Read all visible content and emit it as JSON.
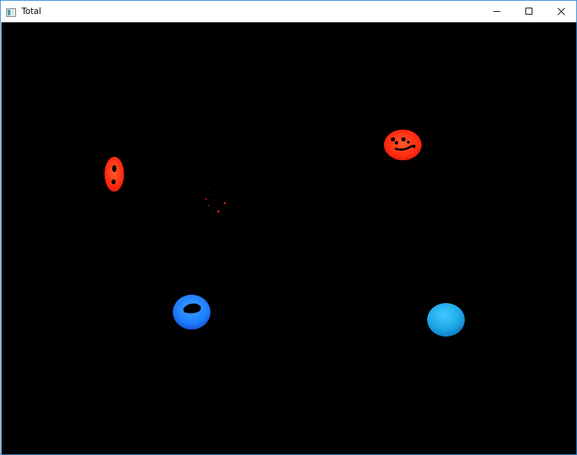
{
  "window": {
    "title": "Total",
    "controls": {
      "minimize_icon": "minimize-icon",
      "maximize_icon": "maximize-icon",
      "close_icon": "close-icon"
    },
    "app_icon": "app-window-icon",
    "border_color": "#2b8ad6"
  },
  "canvas": {
    "background": "#000000",
    "blobs": [
      {
        "name": "red-blob-left",
        "color": "#ff2a10"
      },
      {
        "name": "red-blob-right",
        "color": "#ff2a10"
      },
      {
        "name": "blue-blob-left",
        "color": "#1e7fff"
      },
      {
        "name": "cyan-blob-right",
        "color": "#1ea8e6"
      },
      {
        "name": "red-noise-specks",
        "color": "#c81e0a"
      }
    ]
  }
}
